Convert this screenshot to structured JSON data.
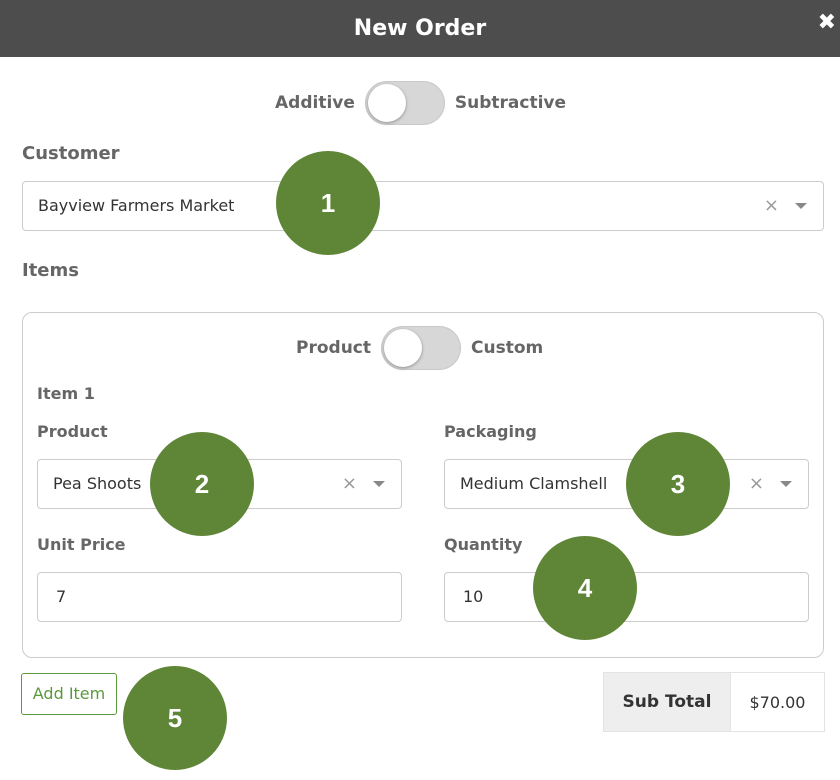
{
  "header": {
    "title": "New Order",
    "close_glyph": "✖"
  },
  "order_mode": {
    "left_label": "Additive",
    "right_label": "Subtractive",
    "state": "Additive"
  },
  "customer": {
    "label": "Customer",
    "value": "Bayview Farmers Market",
    "clear_glyph": "×"
  },
  "items_section": {
    "label": "Items",
    "item_mode": {
      "left_label": "Product",
      "right_label": "Custom",
      "state": "Product"
    },
    "items": [
      {
        "title": "Item 1",
        "product": {
          "label": "Product",
          "value": "Pea Shoots",
          "clear_glyph": "×"
        },
        "packaging": {
          "label": "Packaging",
          "value": "Medium Clamshell",
          "clear_glyph": "×"
        },
        "unit_price": {
          "label": "Unit Price",
          "value": "7"
        },
        "quantity": {
          "label": "Quantity",
          "value": "10"
        }
      }
    ]
  },
  "add_item_label": "Add Item",
  "subtotal": {
    "label": "Sub Total",
    "value": "$70.00"
  },
  "callouts": [
    "1",
    "2",
    "3",
    "4",
    "5"
  ],
  "colors": {
    "header_bg": "#4d4d4d",
    "accent_green": "#5a9a3c",
    "callout_green": "#5e8636"
  }
}
